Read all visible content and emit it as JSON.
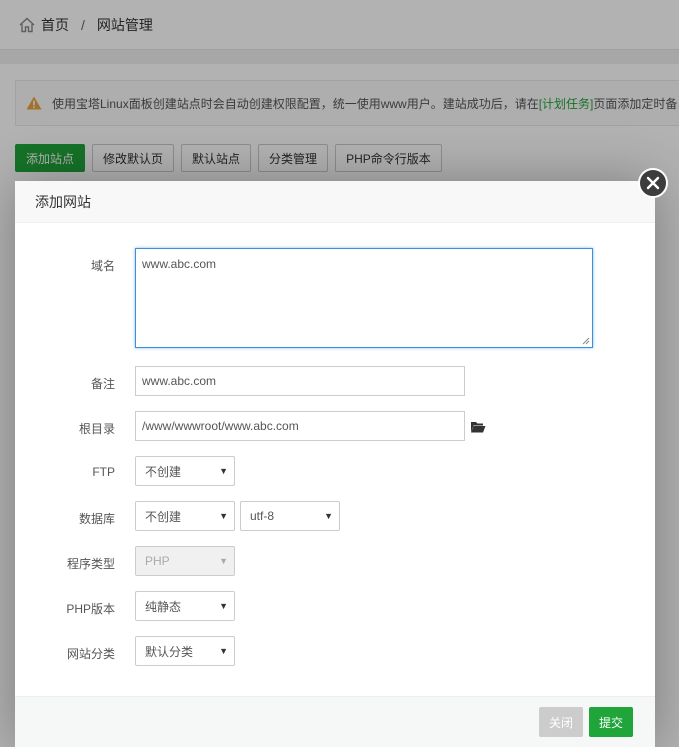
{
  "breadcrumb": {
    "home": "首页",
    "separator": "/",
    "current": "网站管理"
  },
  "alert": {
    "text_before": "使用宝塔Linux面板创建站点时会自动创建权限配置，统一使用www用户。建站成功后，请在",
    "link": "[计划任务]",
    "text_after": "页面添加定时备"
  },
  "toolbar": {
    "add_site": "添加站点",
    "edit_default_page": "修改默认页",
    "default_site": "默认站点",
    "category_manage": "分类管理",
    "php_cli_version": "PHP命令行版本"
  },
  "modal": {
    "title": "添加网站",
    "domain_label": "域名",
    "domain_value": "www.abc.com",
    "remark_label": "备注",
    "remark_value": "www.abc.com",
    "root_label": "根目录",
    "root_value": "/www/wwwroot/www.abc.com",
    "ftp_label": "FTP",
    "ftp_value": "不创建",
    "db_label": "数据库",
    "db_value": "不创建",
    "db_charset": "utf-8",
    "program_label": "程序类型",
    "program_value": "PHP",
    "php_label": "PHP版本",
    "php_value": "纯静态",
    "category_label": "网站分类",
    "category_value": "默认分类",
    "close_label": "关闭",
    "submit_label": "提交"
  },
  "colors": {
    "accent": "#20a53a",
    "focus": "#3b8fdc",
    "warning": "#f0ad4e"
  },
  "icons": {
    "home": "home-icon",
    "warning": "warning-icon",
    "close": "close-icon",
    "folder": "folder-open-icon",
    "caret": "caret-down-icon"
  }
}
